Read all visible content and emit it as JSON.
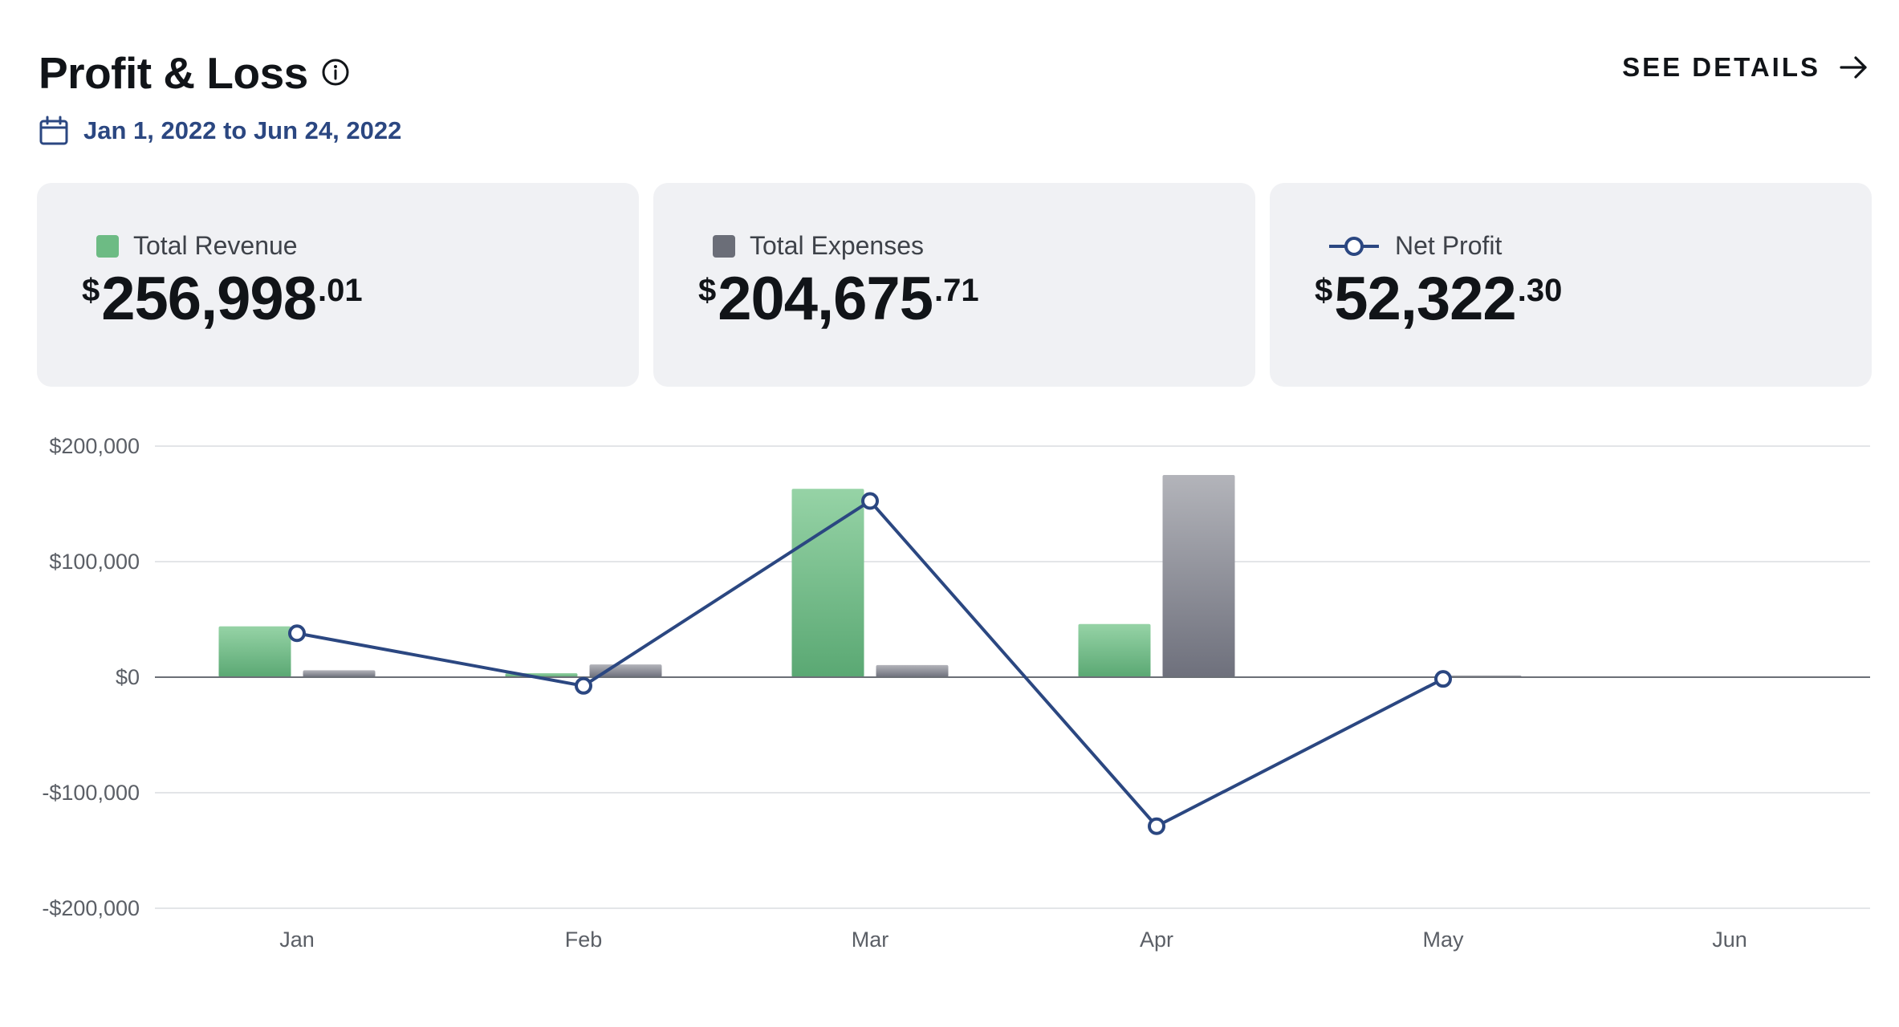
{
  "header": {
    "title": "Profit & Loss",
    "see_details_label": "SEE DETAILS",
    "date_range": "Jan 1, 2022 to Jun 24, 2022"
  },
  "cards": [
    {
      "label": "Total Revenue",
      "currency": "$",
      "whole": "256,998",
      "cents": ".01",
      "color": "#6dbb84"
    },
    {
      "label": "Total Expenses",
      "currency": "$",
      "whole": "204,675",
      "cents": ".71",
      "color": "#6b6e78"
    },
    {
      "label": "Net Profit",
      "currency": "$",
      "whole": "52,322",
      "cents": ".30",
      "color": "#2b4781"
    }
  ],
  "colors": {
    "revenue": "#6dbb84",
    "expenses": "#7b7e88",
    "net_profit_line": "#2b4781",
    "gridline": "#e3e5e8",
    "zero_line": "#6b6f76"
  },
  "chart_data": {
    "type": "bar",
    "categories": [
      "Jan",
      "Feb",
      "Mar",
      "Apr",
      "May",
      "Jun"
    ],
    "series": [
      {
        "name": "Total Revenue",
        "type": "bar",
        "values": [
          44000,
          3500,
          163000,
          46000,
          0,
          0
        ]
      },
      {
        "name": "Total Expenses",
        "type": "bar",
        "values": [
          6000,
          11000,
          10500,
          175000,
          1500,
          0
        ]
      },
      {
        "name": "Net Profit",
        "type": "line",
        "values": [
          38000,
          -7500,
          152500,
          -129000,
          -1500,
          null
        ]
      }
    ],
    "ylim": [
      -200000,
      200000
    ],
    "yticks": [
      200000,
      100000,
      0,
      -100000,
      -200000
    ],
    "ytick_labels": [
      "$200,000",
      "$100,000",
      "$0",
      "-$100,000",
      "-$200,000"
    ],
    "grid": true,
    "legend_placement": "top (summary cards)"
  }
}
